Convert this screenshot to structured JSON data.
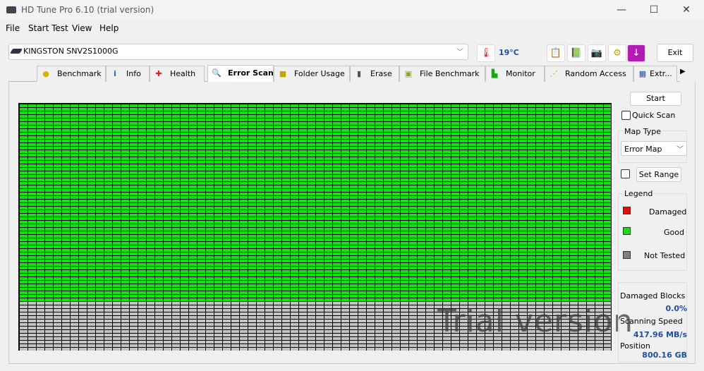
{
  "window": {
    "title": "HD Tune Pro 6.10 (trial version)",
    "minimize": "—",
    "maximize": "☐",
    "close": "✕"
  },
  "menu": [
    "File",
    "Start Test",
    "View",
    "Help"
  ],
  "drive": {
    "name": "KINGSTON SNV2S1000G",
    "temperature": "19°C"
  },
  "toolbar": {
    "exit": "Exit"
  },
  "tabs": [
    "Benchmark",
    "Info",
    "Health",
    "Error Scan",
    "Folder Usage",
    "Erase",
    "File Benchmark",
    "Monitor",
    "Random Access",
    "Extr..."
  ],
  "active_tab": "Error Scan",
  "scan": {
    "start": "Start",
    "quick_scan": "Quick Scan",
    "map_type_label": "Map Type",
    "map_type": "Error Map",
    "set_range": "Set Range",
    "legend_label": "Legend",
    "legend": [
      {
        "label": "Damaged",
        "color": "#e01010"
      },
      {
        "label": "Good",
        "color": "#14e014"
      },
      {
        "label": "Not Tested",
        "color": "#808080"
      }
    ],
    "damaged_blocks_label": "Damaged Blocks",
    "damaged_blocks": "0.0%",
    "speed_label": "Scanning Speed",
    "speed": "417.96 MB/s",
    "position_label": "Position",
    "position": "800.16 GB",
    "progress_fraction": 0.8,
    "watermark": "Trial version"
  }
}
